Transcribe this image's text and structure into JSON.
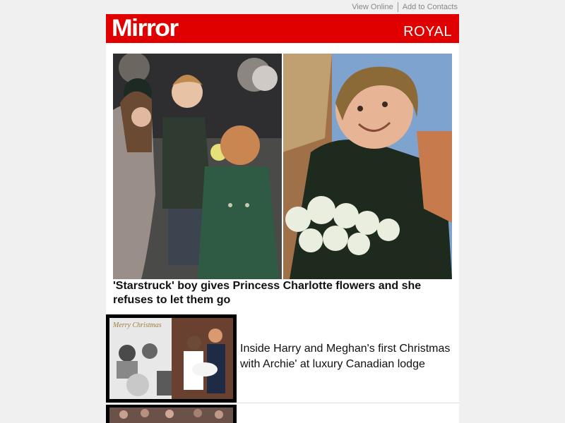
{
  "topbar": {
    "view_online": "View Online",
    "add_contacts": "Add to Contacts"
  },
  "masthead": {
    "logo": "Mirror",
    "section": "ROYAL",
    "brand_color": "#e10000"
  },
  "hero": {
    "headline": "'Starstruck' boy gives Princess Charlotte flowers and she refuses to let them go"
  },
  "stories": [
    {
      "title": "Inside Harry and Meghan's first Christmas with Archie' at luxury Canadian lodge",
      "thumb_caption": "Merry Christmas"
    }
  ]
}
